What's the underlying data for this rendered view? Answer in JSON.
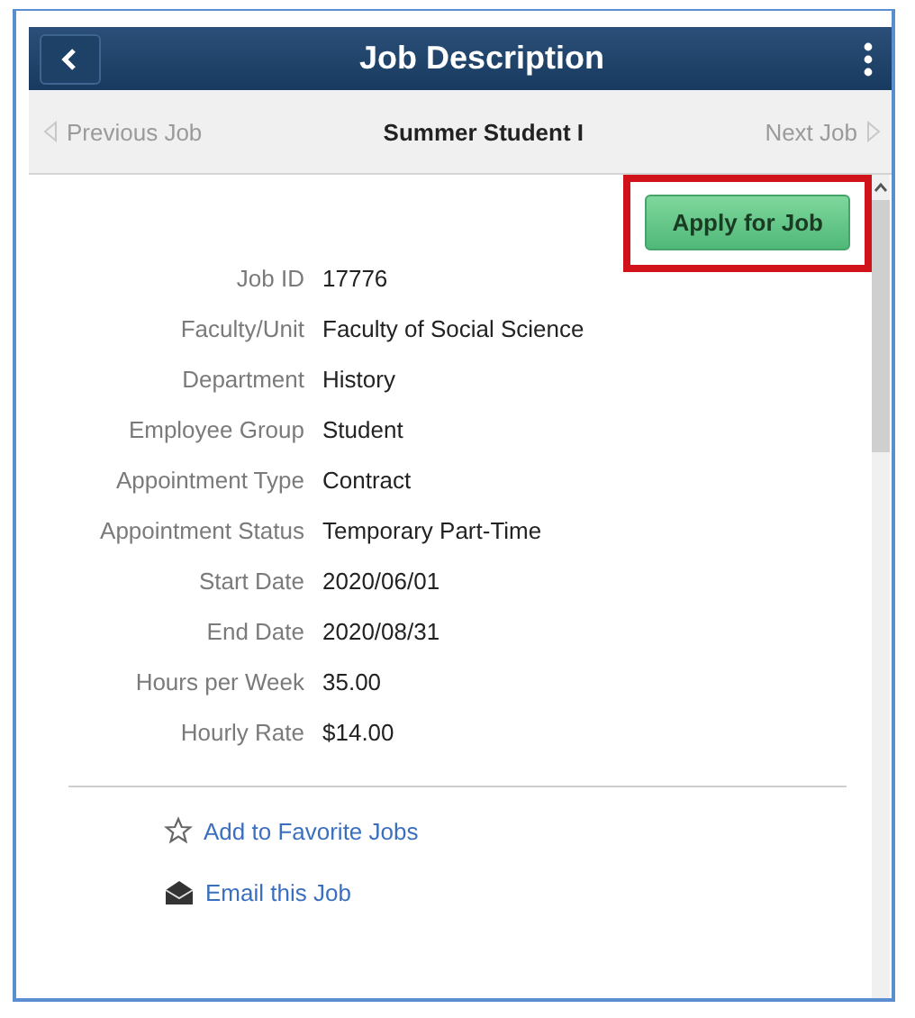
{
  "header": {
    "title": "Job Description"
  },
  "nav": {
    "previous": "Previous Job",
    "current": "Summer Student I",
    "next": "Next Job"
  },
  "apply_button": {
    "label": "Apply for Job",
    "highlighted": true
  },
  "fields": [
    {
      "label": "Job ID",
      "value": "17776"
    },
    {
      "label": "Faculty/Unit",
      "value": "Faculty of Social Science"
    },
    {
      "label": "Department",
      "value": "History"
    },
    {
      "label": "Employee Group",
      "value": "Student"
    },
    {
      "label": "Appointment Type",
      "value": "Contract"
    },
    {
      "label": "Appointment Status",
      "value": "Temporary Part-Time"
    },
    {
      "label": "Start Date",
      "value": "2020/06/01"
    },
    {
      "label": "End Date",
      "value": "2020/08/31"
    },
    {
      "label": "Hours per Week",
      "value": "35.00"
    },
    {
      "label": "Hourly Rate",
      "value": "$14.00"
    }
  ],
  "links": [
    {
      "kind": "favorite",
      "label": "Add to Favorite Jobs"
    },
    {
      "kind": "email",
      "label": "Email this Job"
    }
  ]
}
